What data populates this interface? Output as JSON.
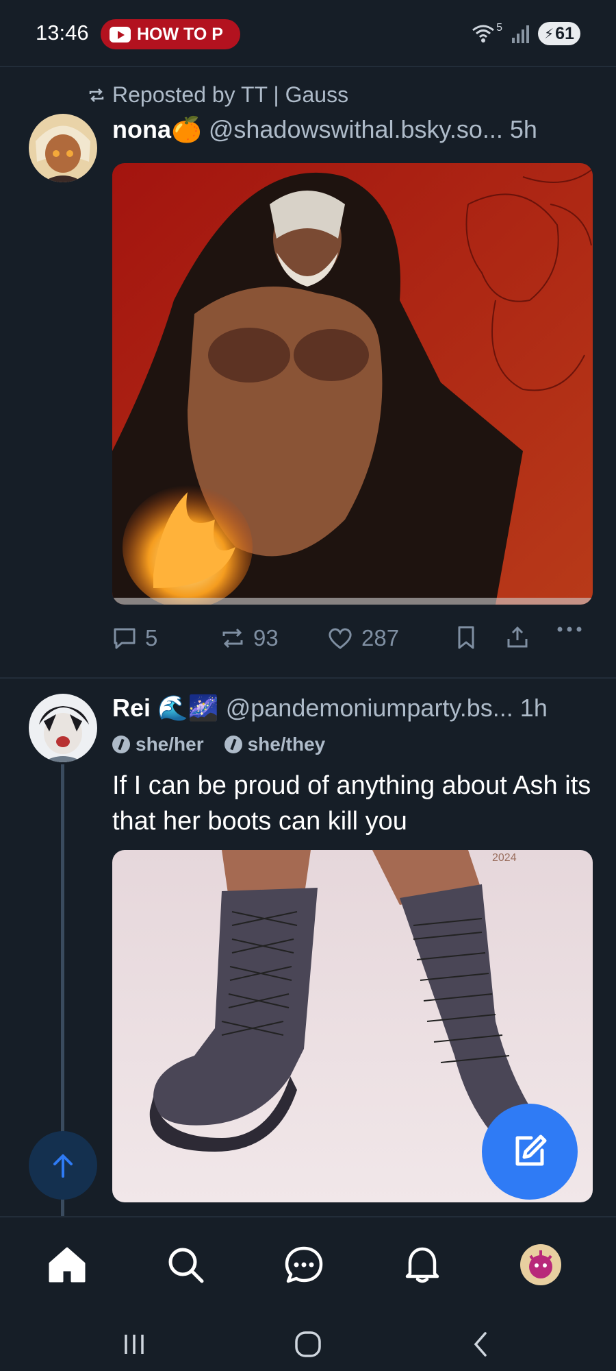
{
  "status_bar": {
    "time": "13:46",
    "notification_pill": "HOW TO P",
    "battery": "61",
    "wifi_badge": "5",
    "icons": [
      "youtube-icon",
      "wifi-icon",
      "signal-icon",
      "battery-icon"
    ]
  },
  "posts": [
    {
      "repost_label": "Reposted by TT | Gauss",
      "display_name": "nona",
      "name_emoji": "🍊",
      "handle": "@shadowswithal.bsky.so...",
      "age": "5h",
      "media": "illustration",
      "stats": {
        "replies": "5",
        "reposts": "93",
        "likes": "287"
      }
    },
    {
      "display_name": "Rei",
      "name_emoji": "🌊🌌",
      "handle": "@pandemoniumparty.bs...",
      "age": "1h",
      "pronouns": [
        "she/her",
        "she/they"
      ],
      "text": "If I can be proud of anything about Ash its that her boots can kill you",
      "media": "illustration",
      "media_watermark": "2024"
    }
  ],
  "fab": {
    "scroll_top": "arrow-up-icon",
    "compose": "compose-icon",
    "compose_color": "#2f7bf5"
  },
  "tab_bar": {
    "tabs": [
      "home-icon",
      "search-icon",
      "chat-icon",
      "bell-icon",
      "profile-avatar"
    ],
    "active": "home-icon"
  },
  "colors": {
    "background": "#161e27",
    "accent": "#2f7bf5",
    "muted": "#7f8fa2"
  }
}
